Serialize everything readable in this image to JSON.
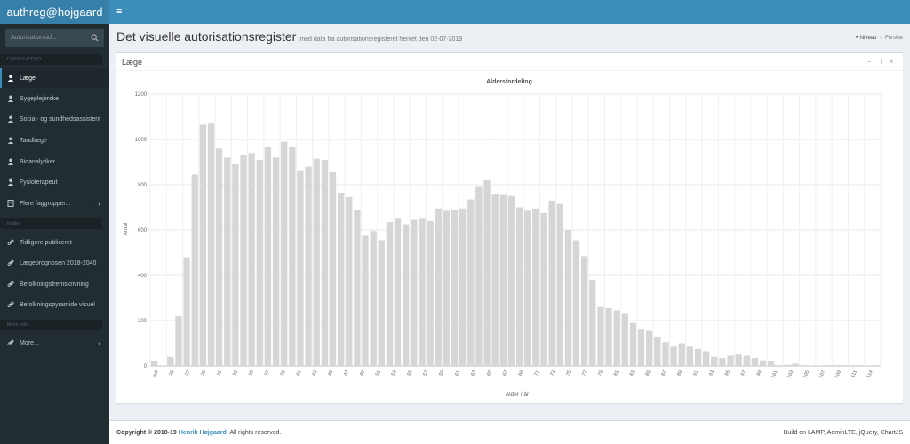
{
  "header": {
    "logo": "authreg@hojgaard",
    "menu_icon": "hamburger-icon"
  },
  "sidebar": {
    "search_placeholder": "Autorisationsid...",
    "sections": {
      "faggrupper": "FAGGRUPPER",
      "kilder": "Kilder",
      "mere": "Mere info"
    },
    "faggrupper": [
      {
        "label": "Læge",
        "icon": "user-icon",
        "active": true
      },
      {
        "label": "Sygeplejerske",
        "icon": "user-icon"
      },
      {
        "label": "Social- og sundhedsassistent",
        "icon": "user-icon"
      },
      {
        "label": "Tandlæge",
        "icon": "user-icon"
      },
      {
        "label": "Bioanalytiker",
        "icon": "user-icon"
      },
      {
        "label": "Fysioterapeut",
        "icon": "user-icon"
      },
      {
        "label": "Flere faggrupper...",
        "icon": "book-icon"
      }
    ],
    "kilder": [
      {
        "label": "Tidligere publiceret",
        "icon": "link-icon"
      },
      {
        "label": "Lægeprognosen 2018-2040",
        "icon": "link-icon"
      },
      {
        "label": "Befolkningsfremskrivning",
        "icon": "link-icon"
      },
      {
        "label": "Befolkningspyramide visuel",
        "icon": "link-icon"
      }
    ],
    "mere": [
      {
        "label": "More...",
        "icon": "link-icon"
      }
    ]
  },
  "content": {
    "title": "Det visuelle autorisationsregister",
    "subtitle": "med data fra autorisationsregisteret hentet den 02-07-2019",
    "breadcrumb": {
      "home": "Niveau",
      "current": "Forside"
    }
  },
  "box": {
    "title": "Læge",
    "tools": [
      "minus-icon",
      "filter-icon",
      "close-icon"
    ],
    "tool_glyphs": [
      "−",
      "⊤",
      "×"
    ]
  },
  "chart_data": {
    "type": "bar",
    "title": "Aldersfordeling",
    "xlabel": "Alder / år",
    "ylabel": "Antal",
    "ylim": [
      0,
      1200
    ],
    "yticks": [
      0,
      200,
      400,
      600,
      800,
      1000,
      1200
    ],
    "xticklabels": [
      "null",
      "25",
      "27",
      "29",
      "31",
      "33",
      "35",
      "37",
      "39",
      "41",
      "43",
      "45",
      "47",
      "49",
      "51",
      "53",
      "55",
      "57",
      "59",
      "61",
      "63",
      "65",
      "67",
      "69",
      "71",
      "73",
      "75",
      "77",
      "79",
      "81",
      "83",
      "85",
      "87",
      "89",
      "91",
      "93",
      "95",
      "97",
      "99",
      "101",
      "103",
      "105",
      "107",
      "109",
      "111",
      "114"
    ],
    "categories": [
      "null",
      "24",
      "25",
      "26",
      "27",
      "28",
      "29",
      "30",
      "31",
      "32",
      "33",
      "34",
      "35",
      "36",
      "37",
      "38",
      "39",
      "40",
      "41",
      "42",
      "43",
      "44",
      "45",
      "46",
      "47",
      "48",
      "49",
      "50",
      "51",
      "52",
      "53",
      "54",
      "55",
      "56",
      "57",
      "58",
      "59",
      "60",
      "61",
      "62",
      "63",
      "64",
      "65",
      "66",
      "67",
      "68",
      "69",
      "70",
      "71",
      "72",
      "73",
      "74",
      "75",
      "76",
      "77",
      "78",
      "79",
      "80",
      "81",
      "82",
      "83",
      "84",
      "85",
      "86",
      "87",
      "88",
      "89",
      "90",
      "91",
      "92",
      "93",
      "94",
      "95",
      "96",
      "97",
      "98",
      "99",
      "100",
      "101",
      "102",
      "103",
      "104",
      "105",
      "106",
      "107",
      "108",
      "109",
      "110",
      "111",
      "114"
    ],
    "values": [
      20,
      0,
      40,
      220,
      480,
      845,
      1065,
      1070,
      960,
      920,
      890,
      930,
      940,
      910,
      965,
      920,
      990,
      965,
      860,
      880,
      915,
      910,
      855,
      765,
      745,
      690,
      575,
      595,
      555,
      635,
      650,
      625,
      645,
      650,
      640,
      695,
      685,
      690,
      695,
      735,
      790,
      820,
      760,
      755,
      750,
      700,
      685,
      695,
      675,
      730,
      715,
      600,
      555,
      485,
      380,
      260,
      255,
      245,
      230,
      190,
      160,
      155,
      130,
      105,
      85,
      100,
      85,
      75,
      65,
      40,
      35,
      45,
      50,
      45,
      35,
      25,
      20,
      0,
      5,
      10,
      3,
      2,
      2,
      0,
      0,
      0,
      0,
      0,
      1,
      0
    ]
  },
  "footer": {
    "copyright": "Copyright © 2018-19",
    "author": "Henrik Højgaard",
    "rights": ". All rights reserved.",
    "build": "Build on LAMP, AdminLTE, jQuery, ChartJS"
  }
}
